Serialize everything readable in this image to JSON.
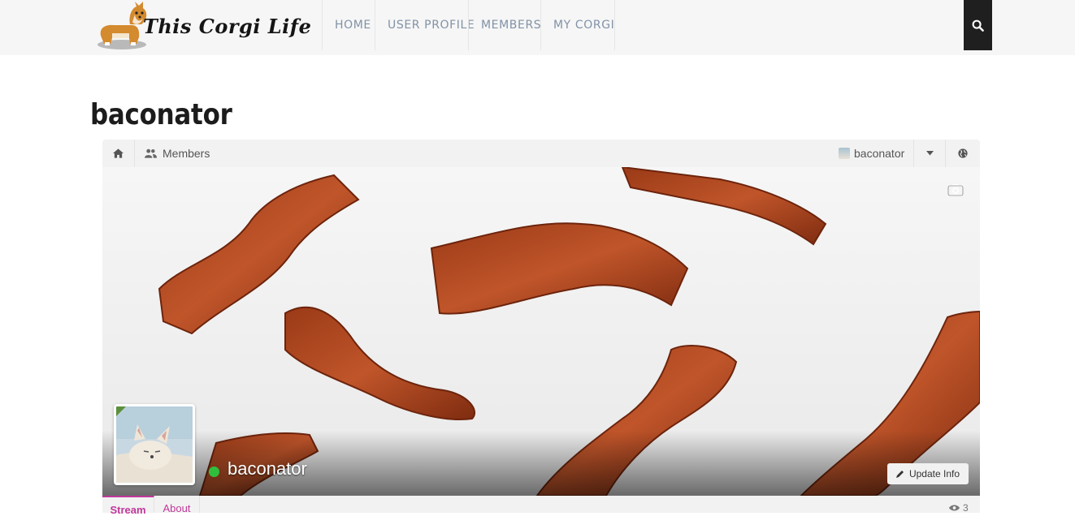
{
  "site": {
    "logo_text": "This Corgi Life",
    "logo_icon": "corgi-icon"
  },
  "nav": {
    "items": [
      {
        "label": "HOME"
      },
      {
        "label": "USER PROFILE"
      },
      {
        "label": "MEMBERS"
      },
      {
        "label": "MY CORGI"
      }
    ],
    "search_icon": "search-icon"
  },
  "page": {
    "title": "baconator"
  },
  "profile_toolbar": {
    "home_icon": "home-icon",
    "members_label": "Members",
    "username": "baconator",
    "caret_icon": "caret-down-icon",
    "globe_icon": "globe-icon"
  },
  "cover": {
    "name": "baconator",
    "online": true,
    "update_label": "Update Info",
    "camera_icon": "camera-icon"
  },
  "tabs": {
    "items": [
      {
        "label": "Stream",
        "active": true
      },
      {
        "label": "About",
        "active": false
      }
    ],
    "view_count": "3"
  },
  "colors": {
    "accent": "#c0399b",
    "online": "#2fbf3d",
    "nav_text": "#8192a6",
    "search_bg": "#1f1f1f"
  }
}
